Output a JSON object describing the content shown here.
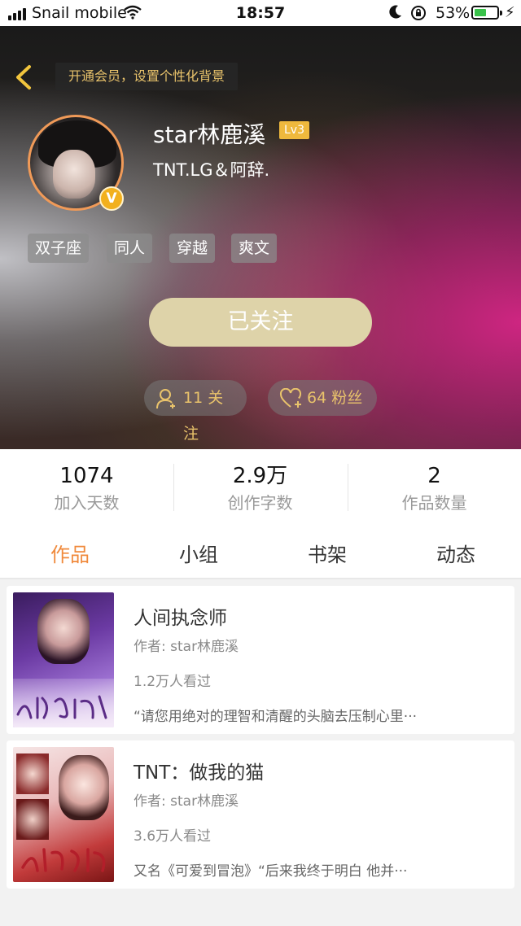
{
  "status_bar": {
    "carrier": "Snail mobile",
    "time": "18:57",
    "battery_percent": "53%",
    "battery_level": 0.53,
    "battery_color": "#39c24a"
  },
  "header": {
    "back_icon": "chevron-left-icon",
    "member_prompt": "开通会员，设置个性化背景",
    "avatar_badge": "V",
    "username": "star林鹿溪",
    "level": "Lv3",
    "bio": "TNT.LG＆阿辞.",
    "tags": [
      "双子座",
      "同人",
      "穿越",
      "爽文"
    ],
    "follow_button": "已关注",
    "following_count": "11 关注",
    "fans_count": "64 粉丝",
    "accent_color": "#e9c36b"
  },
  "stats": [
    {
      "value": "1074",
      "label": "加入天数"
    },
    {
      "value": "2.9万",
      "label": "创作字数"
    },
    {
      "value": "2",
      "label": "作品数量"
    }
  ],
  "tabs": [
    {
      "label": "作品",
      "active": true
    },
    {
      "label": "小组",
      "active": false
    },
    {
      "label": "书架",
      "active": false
    },
    {
      "label": "动态",
      "active": false
    }
  ],
  "works": [
    {
      "title": "人间执念师",
      "author": "作者: star林鹿溪",
      "views": "1.2万人看过",
      "description": "“请您用绝对的理智和清醒的头脑去压制心里···"
    },
    {
      "title": "TNT：做我的猫",
      "author": "作者: star林鹿溪",
      "views": "3.6万人看过",
      "description": "又名《可爱到冒泡》“后来我终于明白 他并···"
    }
  ]
}
